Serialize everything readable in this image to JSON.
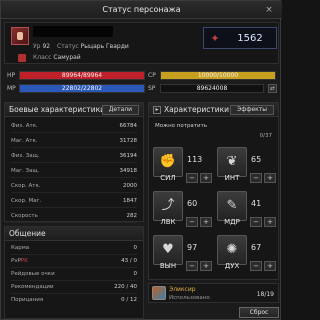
{
  "window": {
    "title": "Статус персонажа",
    "close_icon": "×"
  },
  "header": {
    "level_label": "Ур",
    "level": "92",
    "status_label": "Статус",
    "status_value": "Рыцарь Гварди",
    "class_label": "Класс",
    "class_value": "Самурай",
    "power": "1562"
  },
  "bars": {
    "hp": {
      "label": "HP",
      "value": "89964/89964",
      "fraction": 1.0,
      "color": "#c0202a"
    },
    "mp": {
      "label": "MP",
      "value": "22802/22802",
      "fraction": 1.0,
      "color": "#2a58b8"
    },
    "cp": {
      "label": "CP",
      "value": "10000/10000",
      "fraction": 1.0,
      "color": "#c8a020"
    },
    "sp": {
      "label": "SP",
      "value": "89624008"
    }
  },
  "combat": {
    "title": "Боевые характеристики",
    "details_button": "Детали",
    "rows": [
      {
        "name": "Физ. Атк.",
        "value": "66784"
      },
      {
        "name": "Маг. Атк.",
        "value": "31728"
      },
      {
        "name": "Физ. Защ.",
        "value": "36194"
      },
      {
        "name": "Маг. Защ.",
        "value": "34918"
      },
      {
        "name": "Скор. Атк.",
        "value": "2000"
      },
      {
        "name": "Скор. Маг.",
        "value": "1847"
      },
      {
        "name": "Скорость",
        "value": "282"
      }
    ]
  },
  "general": {
    "title": "Общение",
    "karma_label": "Карма",
    "karma": "0",
    "pvp_label_a": "PvP",
    "pvp_label_b": "PK",
    "pvp": "43 / 0",
    "duel_label": "Рейдовые очки",
    "duel": "0",
    "rec_label": "Рекомендации",
    "rec": "220 / 40",
    "fame_label": "Порицания",
    "fame": "0 / 12"
  },
  "characteristics": {
    "title": "Характеристики",
    "effects_button": "Эффекты",
    "can_spend_label": "Можно потратить",
    "points": "0/37",
    "attributes": [
      {
        "name": "СИЛ",
        "value": "113",
        "icon": "fist-icon"
      },
      {
        "name": "ИНТ",
        "value": "65",
        "icon": "book-icon"
      },
      {
        "name": "ЛВК",
        "value": "60",
        "icon": "boot-icon"
      },
      {
        "name": "МДР",
        "value": "41",
        "icon": "scroll-icon"
      },
      {
        "name": "ВЫН",
        "value": "97",
        "icon": "heart-icon"
      },
      {
        "name": "ДУХ",
        "value": "67",
        "icon": "spirit-icon"
      }
    ],
    "minus": "−",
    "plus": "+"
  },
  "elixir": {
    "name": "Эликсир",
    "sub": "Использовано",
    "count": "18/19"
  },
  "reset_button": "Сброс",
  "colors": {
    "accent": "#e0b040",
    "pk": "#d04040"
  }
}
